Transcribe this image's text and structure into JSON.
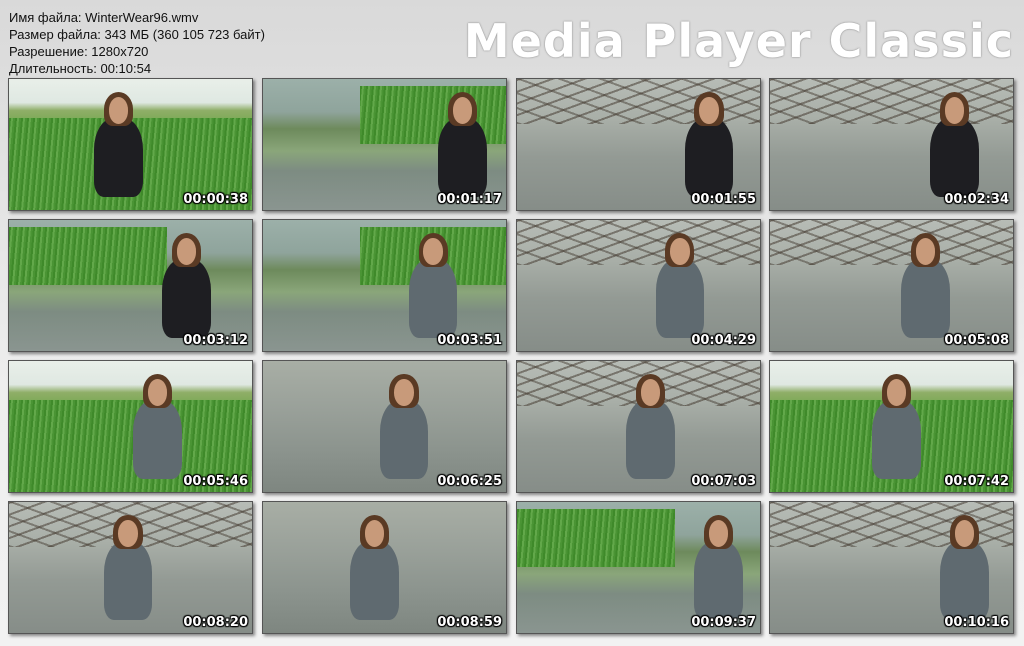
{
  "info": {
    "file_name": "Имя файла: WinterWear96.wmv",
    "file_size": "Размер файла: 343 МБ (360 105 723 байт)",
    "resolution": "Разрешение: 1280x720",
    "duration": "Длительность: 00:10:54"
  },
  "brand": "Media Player Classic",
  "thumbnails": [
    {
      "time": "00:00:38",
      "scene": "field",
      "icon": "woman-in-field-thumbnail"
    },
    {
      "time": "00:01:17",
      "scene": "reed",
      "icon": "woman-entering-water-thumbnail"
    },
    {
      "time": "00:01:55",
      "scene": "branch",
      "icon": "woman-kneeling-in-water-thumbnail"
    },
    {
      "time": "00:02:34",
      "scene": "branch",
      "icon": "woman-lying-in-water-thumbnail"
    },
    {
      "time": "00:03:12",
      "scene": "reed",
      "icon": "woman-walking-reeds-thumbnail"
    },
    {
      "time": "00:03:51",
      "scene": "reed",
      "icon": "woman-standing-water-thumbnail"
    },
    {
      "time": "00:04:29",
      "scene": "branch",
      "icon": "woman-arms-out-thumbnail"
    },
    {
      "time": "00:05:08",
      "scene": "branch",
      "icon": "woman-closeup-water-thumbnail"
    },
    {
      "time": "00:05:46",
      "scene": "field",
      "icon": "woman-in-field-thumbnail"
    },
    {
      "time": "00:06:25",
      "scene": "water",
      "icon": "woman-swimming-thumbnail"
    },
    {
      "time": "00:07:03",
      "scene": "branch",
      "icon": "woman-portrait-water-thumbnail"
    },
    {
      "time": "00:07:42",
      "scene": "field",
      "icon": "woman-grass-lake-thumbnail"
    },
    {
      "time": "00:08:20",
      "scene": "branch",
      "icon": "woman-floating-thumbnail"
    },
    {
      "time": "00:08:59",
      "scene": "water",
      "icon": "woman-wading-thumbnail"
    },
    {
      "time": "00:09:37",
      "scene": "reed",
      "icon": "woman-walking-away-thumbnail"
    },
    {
      "time": "00:10:16",
      "scene": "branch",
      "icon": "woman-floating-thumbnail"
    }
  ]
}
